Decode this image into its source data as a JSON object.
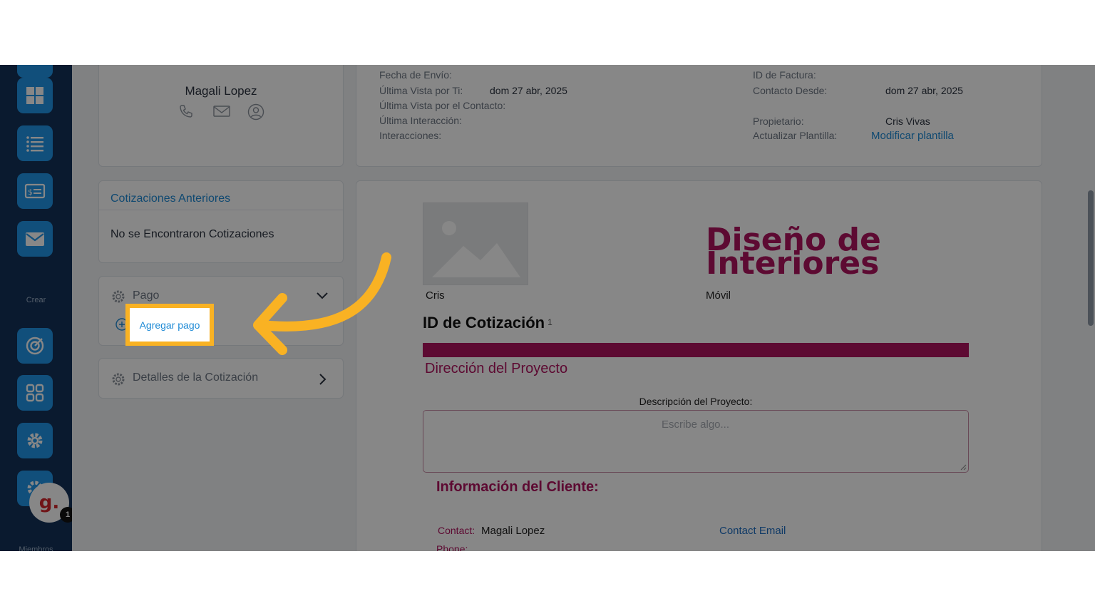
{
  "sidebar": {
    "create_label": "Crear",
    "members_label": "Miembros",
    "badge_letter": "g.",
    "notification_count": "1",
    "accent": "#2196e8"
  },
  "contact_card": {
    "name": "Magali Lopez"
  },
  "info_left": [
    {
      "label": "Fecha de Envío:",
      "value": ""
    },
    {
      "label": "Última Vista por Ti:",
      "value": "dom 27 abr, 2025"
    },
    {
      "label": "Última Vista por el Contacto:",
      "value": ""
    },
    {
      "label": "Última Interacción:",
      "value": ""
    },
    {
      "label": "Interacciones:",
      "value": ""
    }
  ],
  "info_right": [
    {
      "label": "ID de Factura:",
      "value": ""
    },
    {
      "label": "Contacto Desde:",
      "value": "dom 27 abr, 2025"
    },
    {
      "label": "Propietario:",
      "value": "Cris Vivas"
    },
    {
      "label": "Actualizar Plantilla:",
      "value": "Modificar plantilla"
    }
  ],
  "previous_quotes": {
    "title": "Cotizaciones Anteriores",
    "empty_text": "No se Encontraron Cotizaciones"
  },
  "payment": {
    "title": "Pago",
    "add_label": "Agregar pago"
  },
  "quote_details": {
    "title": "Detalles de la Cotización"
  },
  "document": {
    "company_name": "Cris",
    "logo_line1": "Diseño de",
    "logo_line2": "Interiores",
    "mobile_label": "Móvil",
    "quote_id_label": "ID de Cotización",
    "quote_id_number": "1",
    "project_address": "Dirección del Proyecto",
    "project_desc_label": "Descripción del Proyecto:",
    "project_desc_placeholder": "Escribe algo...",
    "client_info_title": "Información del Cliente:",
    "contact_label": "Contact:",
    "contact_value": "Magali Lopez",
    "contact_email": "Contact Email",
    "phone_label": "Phone:",
    "brand_color": "#b0135f"
  },
  "annotation": {
    "arrow_color": "#f9b223"
  }
}
